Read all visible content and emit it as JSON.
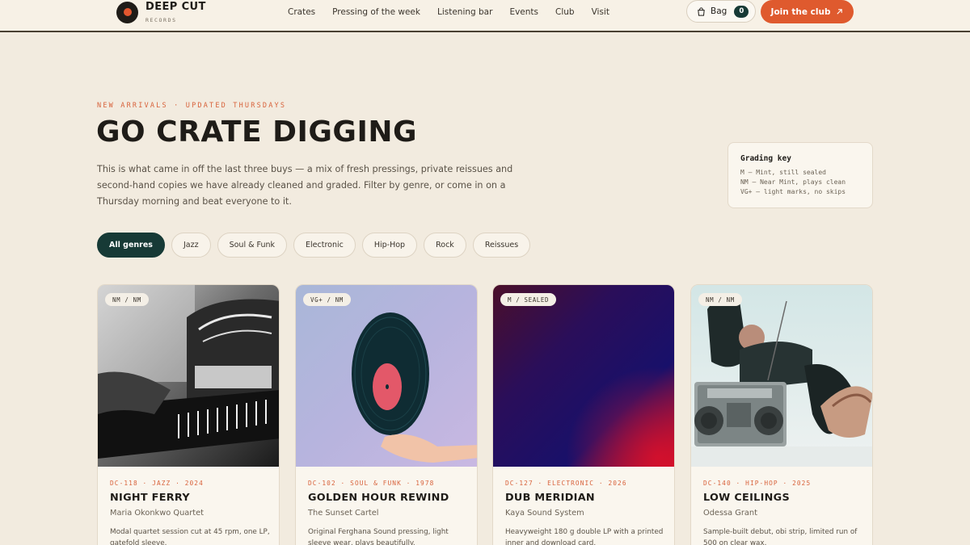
{
  "brand": {
    "name": "DEEP CUT",
    "sub": "RECORDS"
  },
  "nav": [
    "Crates",
    "Pressing of the week",
    "Listening bar",
    "Events",
    "Club",
    "Visit"
  ],
  "bag": {
    "label": "Bag",
    "count": "0"
  },
  "join_label": "Join the club",
  "hero": {
    "eyebrow": "NEW ARRIVALS · UPDATED THURSDAYS",
    "title": "GO CRATE DIGGING",
    "intro": "This is what came in off the last three buys — a mix of fresh pressings, private reissues and second-hand copies we have already cleaned and graded. Filter by genre, or come in on a Thursday morning and beat everyone to it."
  },
  "grading": {
    "title": "Grading key",
    "lines": [
      "M — Mint, still sealed",
      "NM — Near Mint, plays clean",
      "VG+ — light marks, no skips"
    ]
  },
  "filters": [
    "All genres",
    "Jazz",
    "Soul & Funk",
    "Electronic",
    "Hip-Hop",
    "Rock",
    "Reissues"
  ],
  "active_filter": "All genres",
  "cards": [
    {
      "grade": "NM / NM",
      "meta": "DC-118 · JAZZ · 2024",
      "title": "NIGHT FERRY",
      "artist": "Maria Okonkwo Quartet",
      "desc": "Modal quartet session cut at 45 rpm, one LP, gatefold sleeve."
    },
    {
      "grade": "VG+ / NM",
      "meta": "DC-102 · SOUL & FUNK · 1978",
      "title": "GOLDEN HOUR REWIND",
      "artist": "The Sunset Cartel",
      "desc": "Original Ferghana Sound pressing, light sleeve wear, plays beautifully."
    },
    {
      "grade": "M / SEALED",
      "meta": "DC-127 · ELECTRONIC · 2026",
      "title": "DUB MERIDIAN",
      "artist": "Kaya Sound System",
      "desc": "Heavyweight 180 g double LP with a printed inner and download card."
    },
    {
      "grade": "NM / NM",
      "meta": "DC-140 · HIP-HOP · 2025",
      "title": "LOW CEILINGS",
      "artist": "Odessa Grant",
      "desc": "Sample-built debut, obi strip, limited run of 500 on clear wax."
    }
  ],
  "colors": {
    "accent": "#df5a2e",
    "dark": "#173a36",
    "background": "#f2ebdf"
  }
}
